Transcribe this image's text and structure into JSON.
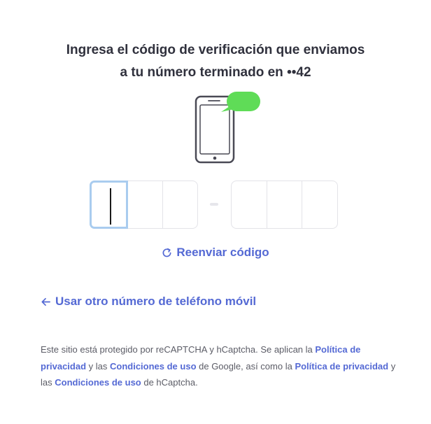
{
  "heading": {
    "line1": "Ingresa el código de verificación que enviamos",
    "line2": "a tu número terminado en ••42"
  },
  "icons": {
    "phone": "phone-message-icon",
    "refresh": "refresh-icon",
    "back": "arrow-left-icon"
  },
  "colors": {
    "link": "#5469d4",
    "bubble": "#5fdc57",
    "focus": "#a9ccef"
  },
  "code_input": {
    "cells": [
      "",
      "",
      "",
      "",
      "",
      ""
    ]
  },
  "resend": {
    "label": "Reenviar código"
  },
  "other_number": {
    "label": "Usar otro número de teléfono móvil"
  },
  "legal": {
    "t1": "Este sitio está protegido por reCAPTCHA y hCaptcha. Se aplican la ",
    "link1": "Política de privacidad",
    "t2": " y las ",
    "link2": "Condiciones de uso",
    "t3": " de Google, así como la ",
    "link3": "Política de privacidad",
    "t4": " y las ",
    "link4": "Condiciones de uso",
    "t5": " de hCaptcha."
  }
}
